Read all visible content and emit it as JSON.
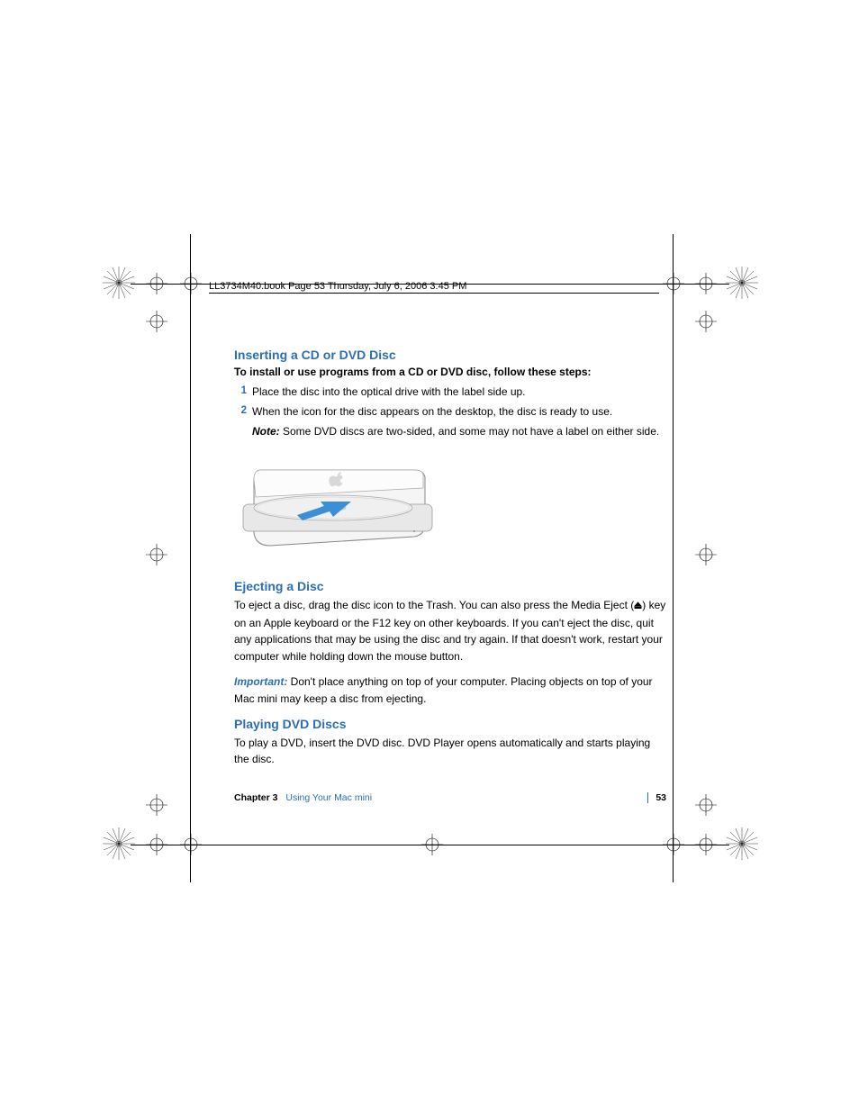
{
  "runhead": "LL3734M40.book  Page 53  Thursday, July 6, 2006  3:45 PM",
  "section1": {
    "heading": "Inserting a CD or DVD Disc",
    "intro_bold": "To install or use programs from a CD or DVD disc, follow these steps:",
    "steps": [
      {
        "num": "1",
        "text": "Place the disc into the optical drive with the label side up."
      },
      {
        "num": "2",
        "text": "When the icon for the disc appears on the desktop, the disc is ready to use."
      }
    ],
    "note_label": "Note:",
    "note_text": "  Some DVD discs are two-sided, and some may not have a label on either side."
  },
  "section2": {
    "heading": "Ejecting a Disc",
    "para1_a": "To eject a disc, drag the disc icon to the Trash. You can also press the Media Eject (",
    "para1_b": ") key on an Apple keyboard or the F12 key on other keyboards. If you can't eject the disc, quit any applications that may be using the disc and try again. If that doesn't work, restart your computer while holding down the mouse button.",
    "important_label": "Important:",
    "important_text": "  Don't place anything on top of your computer. Placing objects on top of your Mac mini may keep a disc from ejecting."
  },
  "section3": {
    "heading": "Playing DVD Discs",
    "para": "To play a DVD, insert the DVD disc. DVD Player opens automatically and starts playing the disc."
  },
  "footer": {
    "chapter": "Chapter 3",
    "title": "Using Your Mac mini",
    "page": "53"
  }
}
